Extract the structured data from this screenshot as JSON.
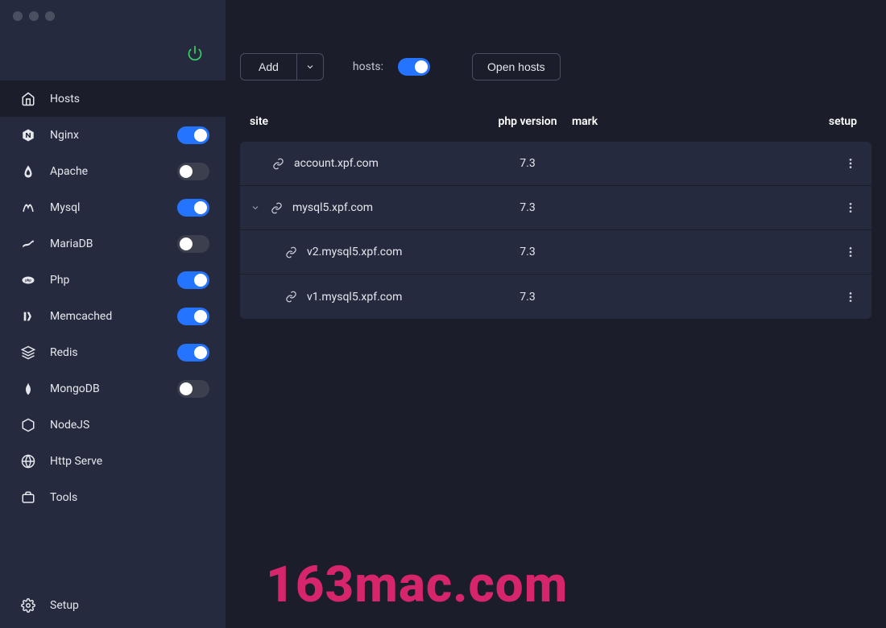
{
  "sidebar": {
    "items": [
      {
        "id": "hosts",
        "label": "Hosts",
        "active": true,
        "toggle": null
      },
      {
        "id": "nginx",
        "label": "Nginx",
        "toggle": true
      },
      {
        "id": "apache",
        "label": "Apache",
        "toggle": false
      },
      {
        "id": "mysql",
        "label": "Mysql",
        "toggle": true
      },
      {
        "id": "mariadb",
        "label": "MariaDB",
        "toggle": false
      },
      {
        "id": "php",
        "label": "Php",
        "toggle": true
      },
      {
        "id": "memcached",
        "label": "Memcached",
        "toggle": true
      },
      {
        "id": "redis",
        "label": "Redis",
        "toggle": true
      },
      {
        "id": "mongodb",
        "label": "MongoDB",
        "toggle": false
      },
      {
        "id": "nodejs",
        "label": "NodeJS",
        "toggle": null
      },
      {
        "id": "httpserve",
        "label": "Http Serve",
        "toggle": null
      },
      {
        "id": "tools",
        "label": "Tools",
        "toggle": null
      }
    ],
    "footer": {
      "label": "Setup"
    }
  },
  "toolbar": {
    "add_label": "Add",
    "hosts_label": "hosts:",
    "hosts_toggle": true,
    "open_hosts_label": "Open hosts"
  },
  "table": {
    "headers": {
      "site": "site",
      "php": "php version",
      "mark": "mark",
      "setup": "setup"
    },
    "rows": [
      {
        "site": "account.xpf.com",
        "php": "7.3",
        "indent": 0,
        "expandable": false
      },
      {
        "site": "mysql5.xpf.com",
        "php": "7.3",
        "indent": 0,
        "expandable": true,
        "expanded": true
      },
      {
        "site": "v2.mysql5.xpf.com",
        "php": "7.3",
        "indent": 1,
        "expandable": false
      },
      {
        "site": "v1.mysql5.xpf.com",
        "php": "7.3",
        "indent": 1,
        "expandable": false
      }
    ]
  },
  "watermark": "163mac.com"
}
